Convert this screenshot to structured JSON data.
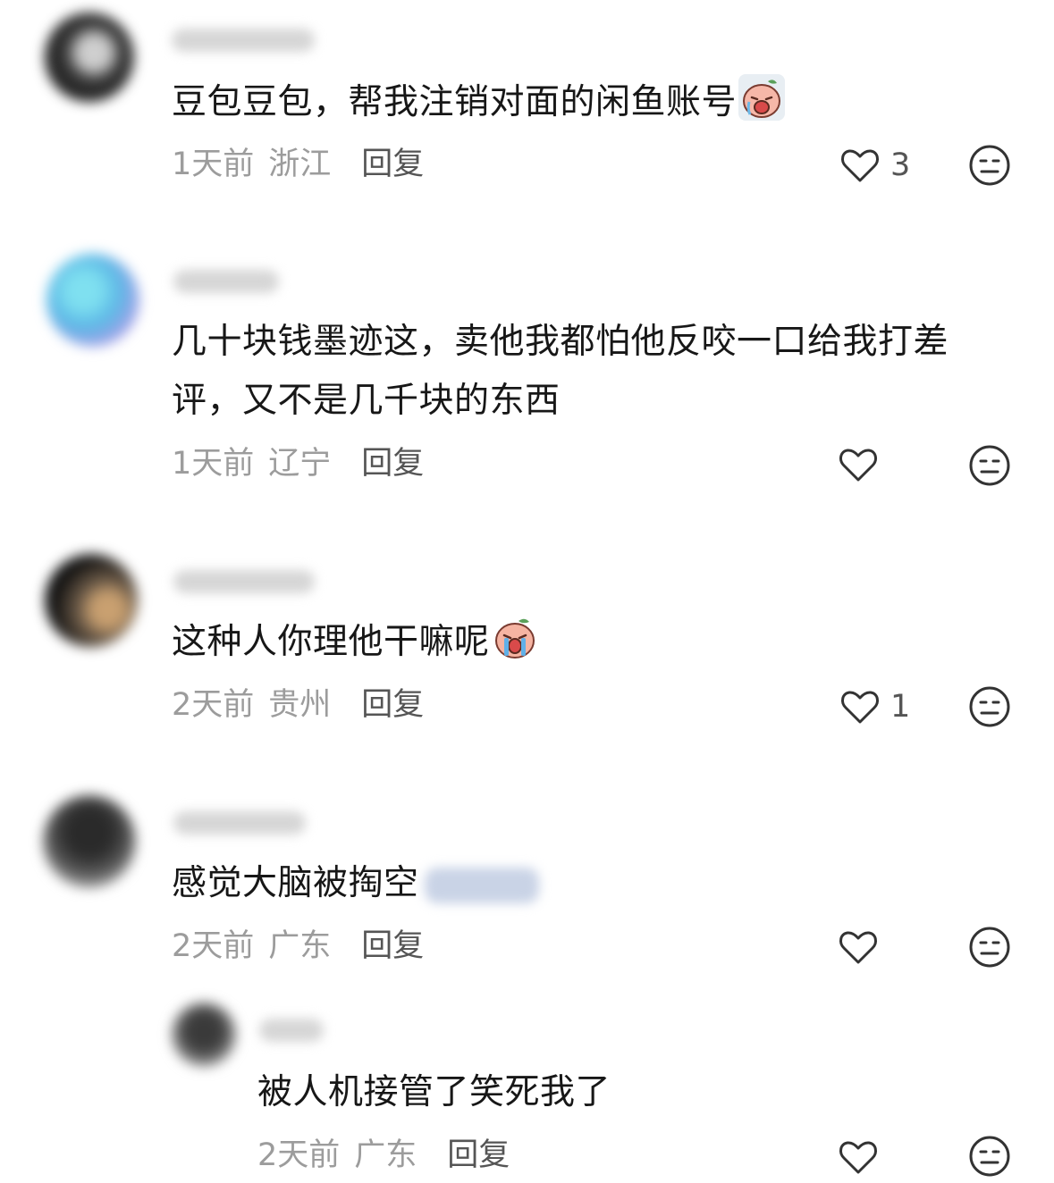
{
  "comments": [
    {
      "text": "豆包豆包，帮我注销对面的闲鱼账号",
      "emoji": "crying-peach-emoji",
      "time": "1天前",
      "location": "浙江",
      "reply_label": "回复",
      "likes": "3"
    },
    {
      "text_line1": "几十块钱墨迹这，卖他我都怕他反咬一口给我打差",
      "text_line2": "评，又不是几千块的东西",
      "time": "1天前",
      "location": "辽宁",
      "reply_label": "回复"
    },
    {
      "text": "这种人你理他干嘛呢",
      "emoji": "sobbing-peach-emoji",
      "time": "2天前",
      "location": "贵州",
      "reply_label": "回复",
      "likes": "1"
    },
    {
      "text": "感觉大脑被掏空",
      "time": "2天前",
      "location": "广东",
      "reply_label": "回复"
    }
  ],
  "reply": {
    "text": "被人机接管了笑死我了",
    "time": "2天前",
    "location": "广东",
    "reply_label": "回复"
  },
  "icons": {
    "like": "heart-outline-icon",
    "dislike": "neutral-face-icon"
  },
  "colors": {
    "text": "#171717",
    "meta": "#9c9c9c",
    "reply_action": "#555555",
    "icon": "#333333"
  }
}
